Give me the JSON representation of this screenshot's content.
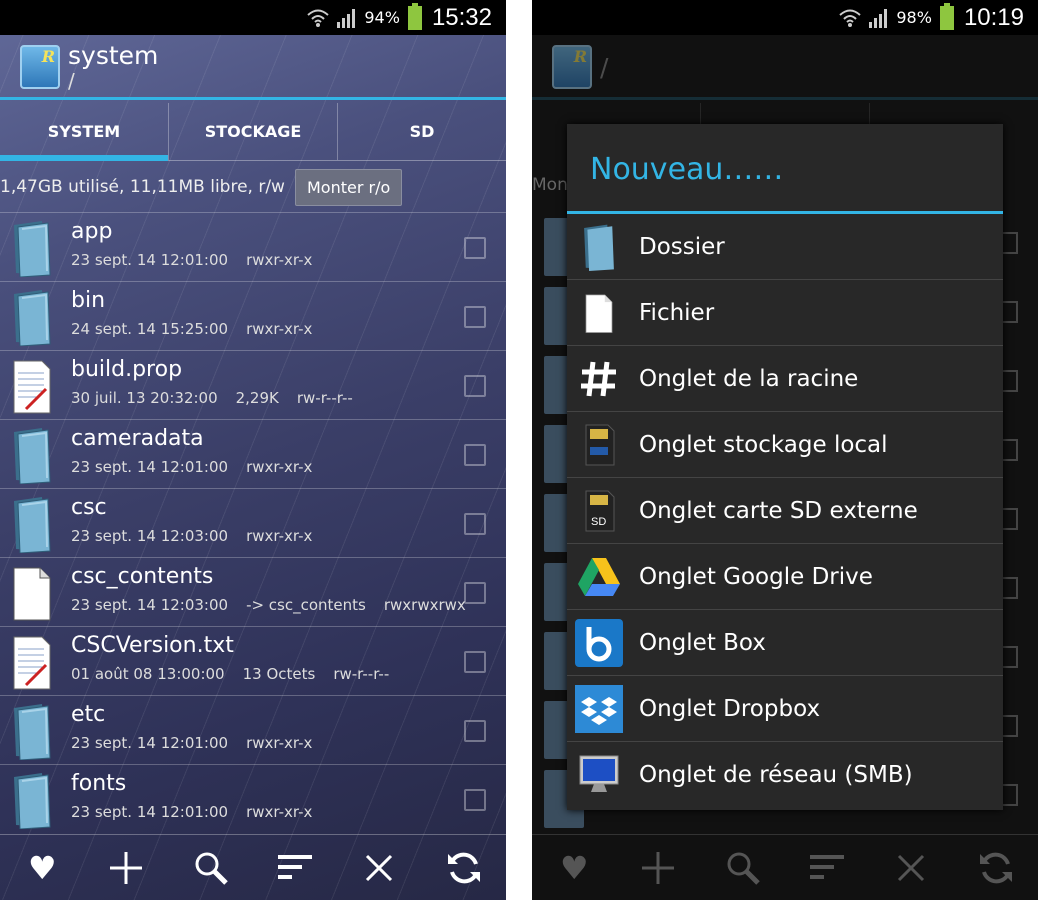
{
  "left": {
    "status": {
      "battery": "94%",
      "time": "15:32"
    },
    "header": {
      "title": "system",
      "path": "/"
    },
    "tabs": [
      "SYSTEM",
      "STOCKAGE",
      "SD"
    ],
    "info": {
      "text": "1,47GB utilisé, 11,11MB libre, r/w",
      "mount_button": "Monter r/o"
    },
    "files": [
      {
        "name": "app",
        "date": "23 sept. 14 12:01:00",
        "size": "",
        "perm": "rwxr-xr-x",
        "type": "folder"
      },
      {
        "name": "bin",
        "date": "24 sept. 14 15:25:00",
        "size": "",
        "perm": "rwxr-xr-x",
        "type": "folder"
      },
      {
        "name": "build.prop",
        "date": "30 juil. 13 20:32:00",
        "size": "2,29K",
        "perm": "rw-r--r--",
        "type": "text"
      },
      {
        "name": "cameradata",
        "date": "23 sept. 14 12:01:00",
        "size": "",
        "perm": "rwxr-xr-x",
        "type": "folder"
      },
      {
        "name": "csc",
        "date": "23 sept. 14 12:03:00",
        "size": "",
        "perm": "rwxr-xr-x",
        "type": "folder"
      },
      {
        "name": "csc_contents",
        "date": "23 sept. 14 12:03:00",
        "size": "-> csc_contents",
        "perm": "rwxrwxrwx",
        "type": "file"
      },
      {
        "name": "CSCVersion.txt",
        "date": "01 août 08 13:00:00",
        "size": "13 Octets",
        "perm": "rw-r--r--",
        "type": "text"
      },
      {
        "name": "etc",
        "date": "23 sept. 14 12:01:00",
        "size": "",
        "perm": "rwxr-xr-x",
        "type": "folder"
      },
      {
        "name": "fonts",
        "date": "23 sept. 14 12:01:00",
        "size": "",
        "perm": "rwxr-xr-x",
        "type": "folder"
      }
    ],
    "bottom": [
      "heart-icon",
      "plus-icon",
      "search-icon",
      "sort-icon",
      "close-icon",
      "refresh-icon"
    ]
  },
  "right": {
    "status": {
      "battery": "98%",
      "time": "10:19"
    },
    "header": {
      "path": "/"
    },
    "bg_info": "Mon",
    "dialog": {
      "title": "Nouveau……",
      "options": [
        {
          "label": "Dossier",
          "icon": "folder-icon"
        },
        {
          "label": "Fichier",
          "icon": "file-icon"
        },
        {
          "label": "Onglet de la racine",
          "icon": "hash-icon"
        },
        {
          "label": "Onglet stockage local",
          "icon": "sdcard-icon"
        },
        {
          "label": "Onglet carte SD externe",
          "icon": "sd-external-icon"
        },
        {
          "label": "Onglet Google Drive",
          "icon": "google-drive-icon"
        },
        {
          "label": "Onglet Box",
          "icon": "box-icon"
        },
        {
          "label": "Onglet Dropbox",
          "icon": "dropbox-icon"
        },
        {
          "label": "Onglet de réseau (SMB)",
          "icon": "network-monitor-icon"
        }
      ]
    }
  },
  "colors": {
    "accent": "#33b5e5",
    "dialog_bg": "#282828"
  }
}
